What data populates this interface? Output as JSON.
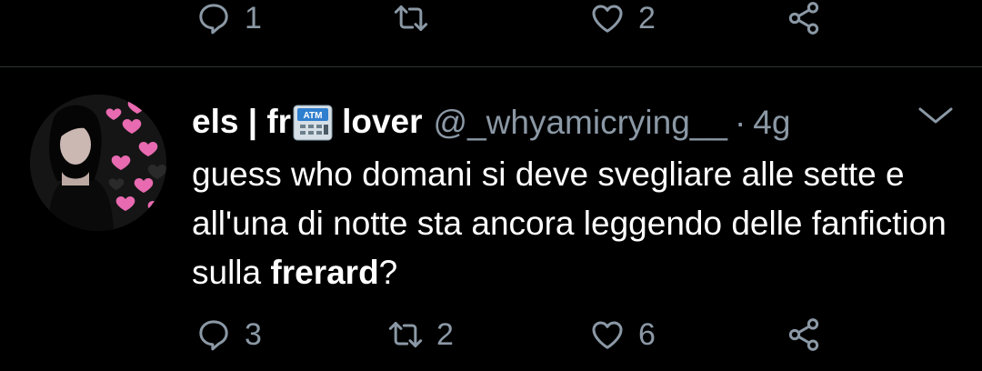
{
  "top_actions": {
    "reply_count": "1",
    "retweet_count": "",
    "like_count": "2"
  },
  "tweet": {
    "display_name_left": "els | fr",
    "display_name_emoji": "ATM",
    "display_name_right": "lover",
    "handle": "@_whyamicrying__",
    "separator": "·",
    "time": "4g",
    "text_before": "guess who domani si deve svegliare alle sette e all'una di notte sta ancora leggendo delle fanfiction sulla ",
    "text_bold": "frerard",
    "text_after": "?"
  },
  "bottom_actions": {
    "reply_count": "3",
    "retweet_count": "2",
    "like_count": "6"
  },
  "colors": {
    "background": "#000000",
    "text": "#ffffff",
    "secondary": "#8b98a5",
    "divider": "#2f3336"
  },
  "icons": [
    "reply-icon",
    "retweet-icon",
    "like-icon",
    "share-icon",
    "chevron-down-icon",
    "atm-emoji-icon"
  ]
}
